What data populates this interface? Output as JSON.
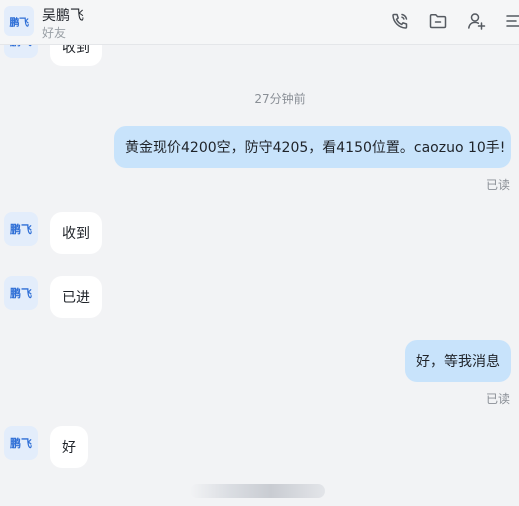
{
  "header": {
    "avatar_text": "鹏飞",
    "name": "吴鹏飞",
    "subtitle": "好友",
    "icons": [
      "phone-icon",
      "folder-icon",
      "add-user-icon",
      "menu-icon"
    ]
  },
  "messages": {
    "partial_top_text": "收到",
    "timestamp": "27分钟前",
    "outgoing_1": "黄金现价4200空，防守4205，看4150位置。caozuo 10手!",
    "read_1": "已读",
    "incoming_1": "收到",
    "incoming_2": "已进",
    "outgoing_2": "好，等我消息",
    "read_2": "已读",
    "incoming_3": "好",
    "avatar_text": "鹏飞"
  },
  "colors": {
    "background": "#f2f3f5",
    "outgoing_bubble": "#c8e3fb",
    "incoming_bubble": "#ffffff",
    "avatar_bg": "#e3edfb",
    "avatar_text": "#2f6fd6"
  }
}
